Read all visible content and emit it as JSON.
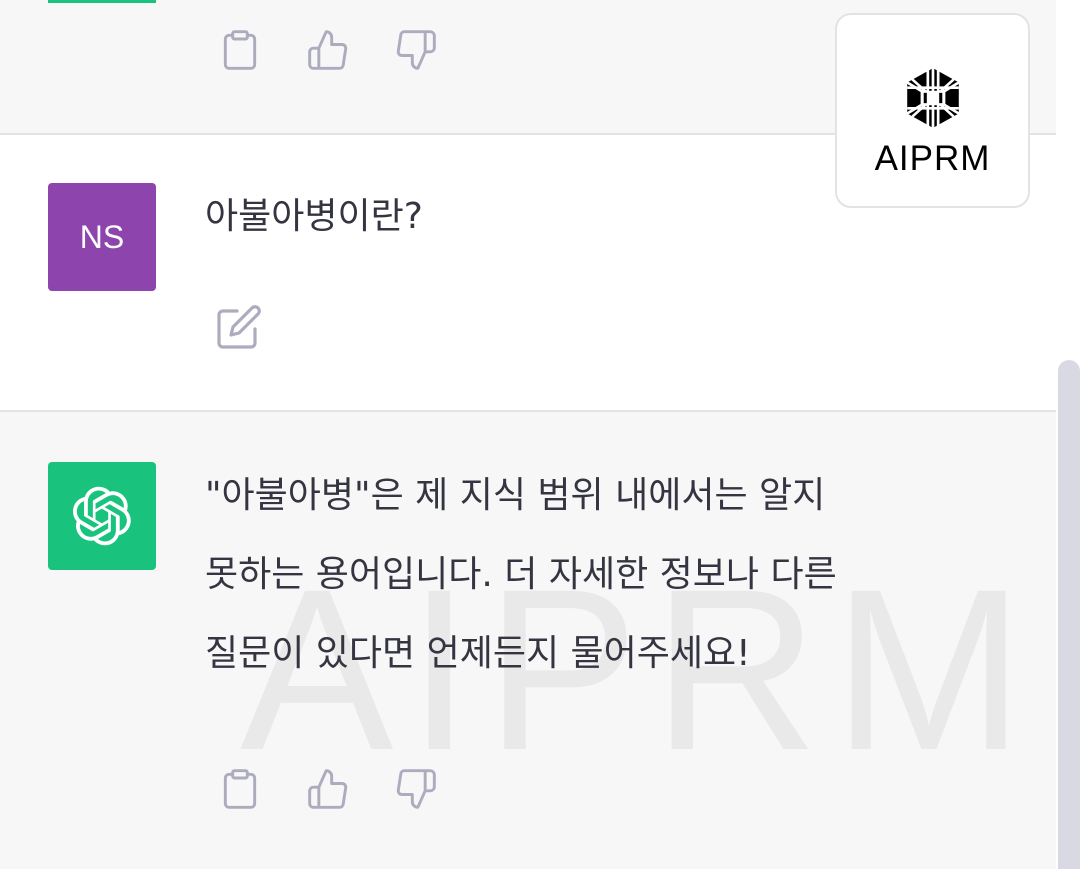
{
  "top_message": {
    "actions": [
      {
        "icon": "clipboard-icon"
      },
      {
        "icon": "thumbs-up-icon"
      },
      {
        "icon": "thumbs-down-icon"
      }
    ]
  },
  "user_message": {
    "avatar_initials": "NS",
    "avatar_color": "#8e44ad",
    "text": "아불아병이란?",
    "edit_icon": "edit-icon"
  },
  "assistant_message": {
    "avatar_color": "#19c37d",
    "avatar_icon": "openai-logo-icon",
    "lines": [
      "\"아불아병\"은 제 지식 범위 내에서는 알지",
      "못하는 용어입니다. 더 자세한 정보나 다른",
      "질문이 있다면 언제든지 물어주세요!"
    ],
    "actions": [
      {
        "icon": "clipboard-icon"
      },
      {
        "icon": "thumbs-up-icon"
      },
      {
        "icon": "thumbs-down-icon"
      }
    ]
  },
  "aiprm_badge": {
    "label": "AIPRM",
    "watermark": "AIPRM"
  },
  "colors": {
    "background": "#f7f7f8",
    "user_background": "#ffffff",
    "divider": "#e3e3e7",
    "icon_gray": "#acacbe"
  }
}
